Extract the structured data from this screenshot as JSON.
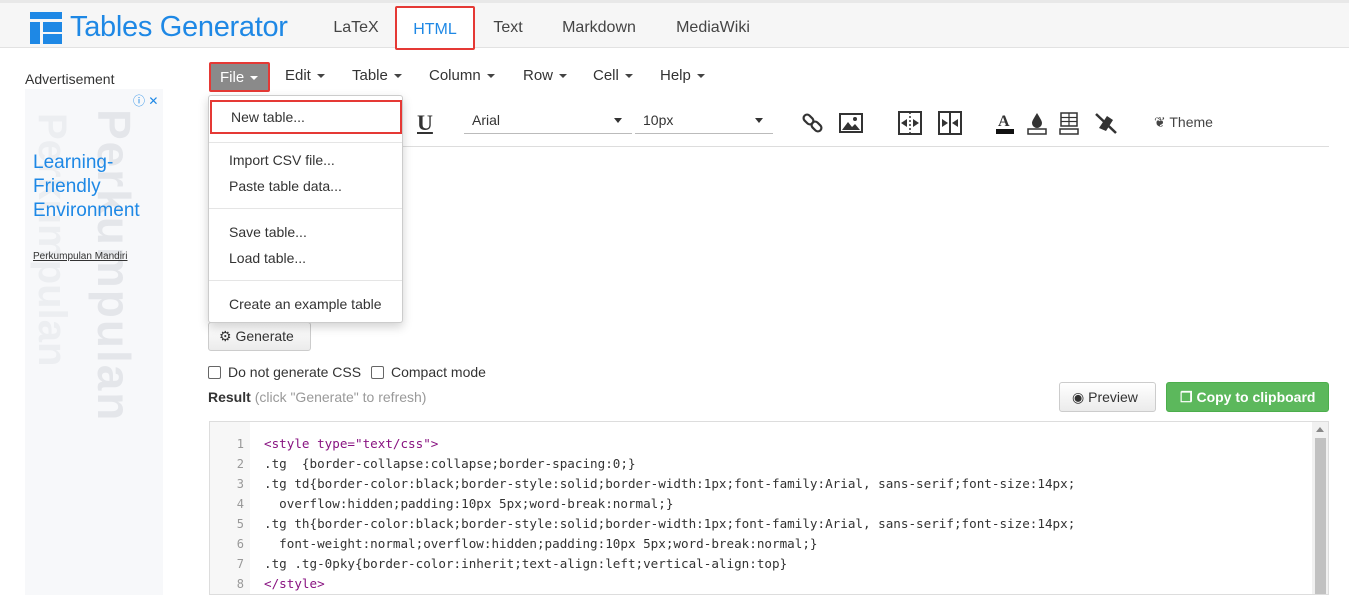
{
  "app": {
    "title": "Tables Generator",
    "accent": "#1e88e5"
  },
  "nav": {
    "tabs": [
      {
        "label": "LaTeX"
      },
      {
        "label": "HTML",
        "active": true
      },
      {
        "label": "Text"
      },
      {
        "label": "Markdown"
      },
      {
        "label": "MediaWiki"
      }
    ]
  },
  "ad": {
    "label": "Advertisement",
    "info": "ⓘ ✕",
    "title": "Learning-Friendly Environment",
    "sponsor": "Perkumpulan Mandiri",
    "watermark": "Perkumpulan",
    "watermark2": "Perkumpulan"
  },
  "menu": {
    "items": [
      {
        "label": "File"
      },
      {
        "label": "Edit"
      },
      {
        "label": "Table"
      },
      {
        "label": "Column"
      },
      {
        "label": "Row"
      },
      {
        "label": "Cell"
      },
      {
        "label": "Help"
      }
    ]
  },
  "toolbar": {
    "underline": "U",
    "font_family": "Arial",
    "font_size": "10px",
    "theme_label": "Theme",
    "theme_icon": "leaf-icon"
  },
  "file_menu": {
    "new_table": "New table...",
    "import_csv": "Import CSV file...",
    "paste_data": "Paste table data...",
    "save_table": "Save table...",
    "load_table": "Load table...",
    "example_table": "Create an example table"
  },
  "generate": {
    "label": "Generate"
  },
  "options": {
    "no_css": "Do not generate CSS",
    "compact": "Compact mode"
  },
  "result": {
    "label": "Result",
    "hint": "(click \"Generate\" to refresh)"
  },
  "buttons": {
    "preview": "Preview",
    "copy": "Copy to clipboard"
  },
  "code": {
    "lines": [
      {
        "n": "1",
        "text": "<style type=\"text/css\">"
      },
      {
        "n": "2",
        "text": ".tg  {border-collapse:collapse;border-spacing:0;}"
      },
      {
        "n": "3",
        "text": ".tg td{border-color:black;border-style:solid;border-width:1px;font-family:Arial, sans-serif;font-size:14px;"
      },
      {
        "n": "4",
        "text": "  overflow:hidden;padding:10px 5px;word-break:normal;}"
      },
      {
        "n": "5",
        "text": ".tg th{border-color:black;border-style:solid;border-width:1px;font-family:Arial, sans-serif;font-size:14px;"
      },
      {
        "n": "6",
        "text": "  font-weight:normal;overflow:hidden;padding:10px 5px;word-break:normal;}"
      },
      {
        "n": "7",
        "text": ".tg .tg-0pky{border-color:inherit;text-align:left;vertical-align:top}"
      },
      {
        "n": "8",
        "text": "</style>"
      }
    ]
  }
}
